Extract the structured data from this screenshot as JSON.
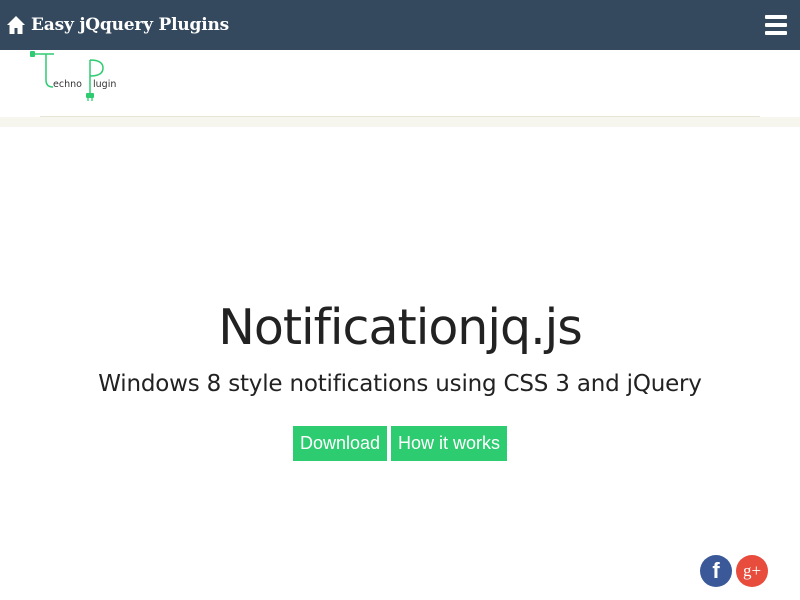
{
  "header": {
    "brand_label": "Easy jQquery Plugins",
    "home_icon": "home-icon",
    "menu_icon": "hamburger-menu-icon",
    "background_color": "#34495e"
  },
  "logo": {
    "text_part1": "echno",
    "text_part2": "lugin",
    "accent_color": "#2ecc71"
  },
  "hero": {
    "title": "Notificationjq.js",
    "subtitle": "Windows 8 style notifications using CSS 3 and jQuery",
    "buttons": [
      {
        "label": "Download"
      },
      {
        "label": "How it works"
      }
    ],
    "button_color": "#2ecc71"
  },
  "social": {
    "facebook_glyph": "f",
    "googleplus_glyph": "g+",
    "facebook_color": "#3b5998",
    "googleplus_color": "#e74c3c"
  }
}
